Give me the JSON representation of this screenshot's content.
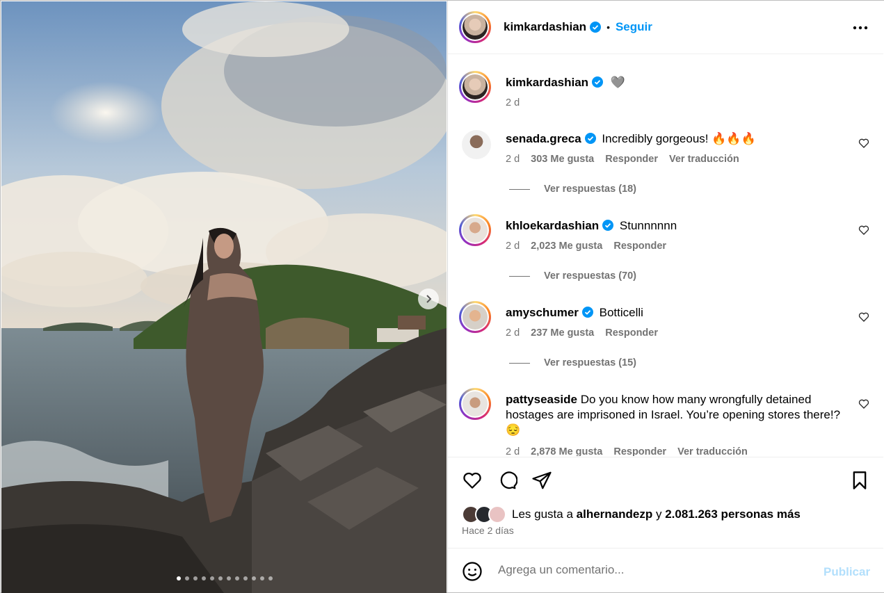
{
  "post": {
    "author": "kimkardashian",
    "follow_label": "Seguir",
    "separator": "•",
    "caption_emoji": "🩶",
    "caption_time": "2 d",
    "more_icon": "ellipsis-icon",
    "carousel_count": 12,
    "carousel_active_index": 0
  },
  "comments": [
    {
      "username": "senada.greca",
      "verified": true,
      "text": "Incredibly gorgeous! 🔥🔥🔥",
      "time": "2 d",
      "likes": "303 Me gusta",
      "reply": "Responder",
      "translate": "Ver traducción",
      "replies": "Ver respuestas (18)"
    },
    {
      "username": "khloekardashian",
      "verified": true,
      "text": "Stunnnnnn",
      "time": "2 d",
      "likes": "2,023 Me gusta",
      "reply": "Responder",
      "replies": "Ver respuestas (70)"
    },
    {
      "username": "amyschumer",
      "verified": true,
      "text": "Botticelli",
      "time": "2 d",
      "likes": "237 Me gusta",
      "reply": "Responder",
      "replies": "Ver respuestas (15)"
    },
    {
      "username": "pattyseaside",
      "verified": false,
      "text": "Do you know how many wrongfully detained hostages are imprisoned in Israel. You’re opening stores there!? 😔",
      "time": "2 d",
      "likes": "2,878 Me gusta",
      "reply": "Responder",
      "translate": "Ver traducción"
    }
  ],
  "likes_line": {
    "prefix": "Les gusta a",
    "user": "alhernandezp",
    "conj": "y",
    "others": "2.081.263 personas más"
  },
  "posted": "Hace 2 días",
  "composer": {
    "placeholder": "Agrega un comentario...",
    "publish": "Publicar"
  },
  "colors": {
    "link": "#0095f6",
    "muted": "#737373",
    "publish_disabled": "#b2dffc",
    "verified": "#0095f6"
  }
}
